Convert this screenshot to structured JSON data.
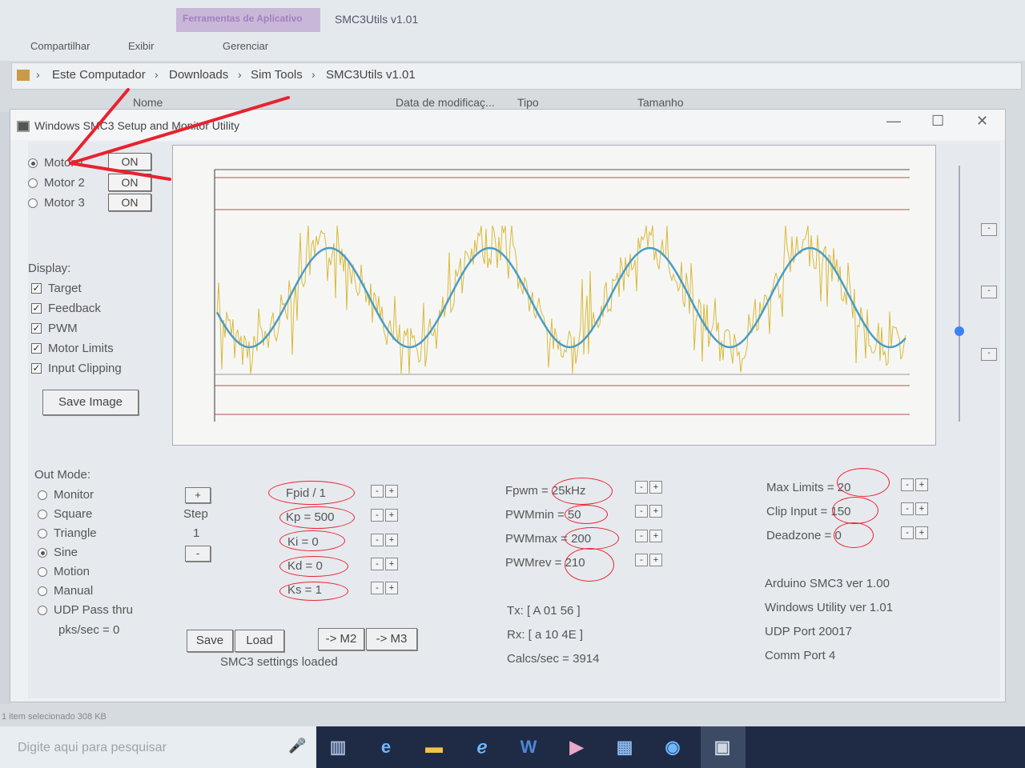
{
  "explorer": {
    "ribbon_context_tab": "Ferramentas de Aplicativo",
    "app_title": "SMC3Utils v1.01",
    "tabs": [
      "Compartilhar",
      "Exibir",
      "Gerenciar"
    ],
    "breadcrumb": [
      "Este Computador",
      "Downloads",
      "Sim Tools",
      "SMC3Utils v1.01"
    ],
    "columns": [
      "Nome",
      "Data de modificaç...",
      "Tipo",
      "Tamanho"
    ],
    "status": "1 item selecionado  308 KB"
  },
  "taskbar": {
    "search_placeholder": "Digite aqui para pesquisar"
  },
  "window": {
    "title": "Windows SMC3 Setup and Monitor Utility",
    "minimize": "—",
    "maximize": "☐",
    "close": "✕"
  },
  "motors": [
    {
      "label": "Motor 1",
      "selected": true,
      "button": "ON"
    },
    {
      "label": "Motor 2",
      "selected": false,
      "button": "ON"
    },
    {
      "label": "Motor 3",
      "selected": false,
      "button": "ON"
    }
  ],
  "display": {
    "heading": "Display:",
    "options": [
      "Target",
      "Feedback",
      "PWM",
      "Motor Limits",
      "Input Clipping"
    ],
    "save_image": "Save Image"
  },
  "out_mode": {
    "heading": "Out Mode:",
    "options": [
      "Monitor",
      "Square",
      "Triangle",
      "Sine",
      "Motion",
      "Manual",
      "UDP Pass thru"
    ],
    "selected": "Sine",
    "pks": "pks/sec = 0"
  },
  "step": {
    "plus": "+",
    "label": "Step",
    "value": "1",
    "minus": "-"
  },
  "pid": [
    "Fpid / 1",
    "Kp = 500",
    "Ki = 0",
    "Kd = 0",
    "Ks = 1"
  ],
  "pwm": [
    "Fpwm = 25kHz",
    "PWMmin = 50",
    "PWMmax = 200",
    "PWMrev = 210"
  ],
  "limits": [
    "Max Limits = 20",
    "Clip Input = 150",
    "Deadzone = 0"
  ],
  "bottom_buttons": {
    "save": "Save",
    "load": "Load",
    "to_m2": "-> M2",
    "to_m3": "-> M3",
    "status": "SMC3 settings loaded"
  },
  "comms": {
    "tx": "Tx: [ A 01 56 ]",
    "rx": "Rx: [ a 10 4E ]",
    "calcs": "Calcs/sec = 3914"
  },
  "info": [
    "Arduino SMC3 ver 1.00",
    "Windows Utility ver 1.01",
    "UDP Port 20017",
    "Comm Port 4"
  ],
  "spin_labels": {
    "minus": "-",
    "plus": "+"
  },
  "colors": {
    "target": "#4a9cc7",
    "feedback": "#d9b93a",
    "limit_line": "#b5504a",
    "annotation": "#e8222e"
  }
}
